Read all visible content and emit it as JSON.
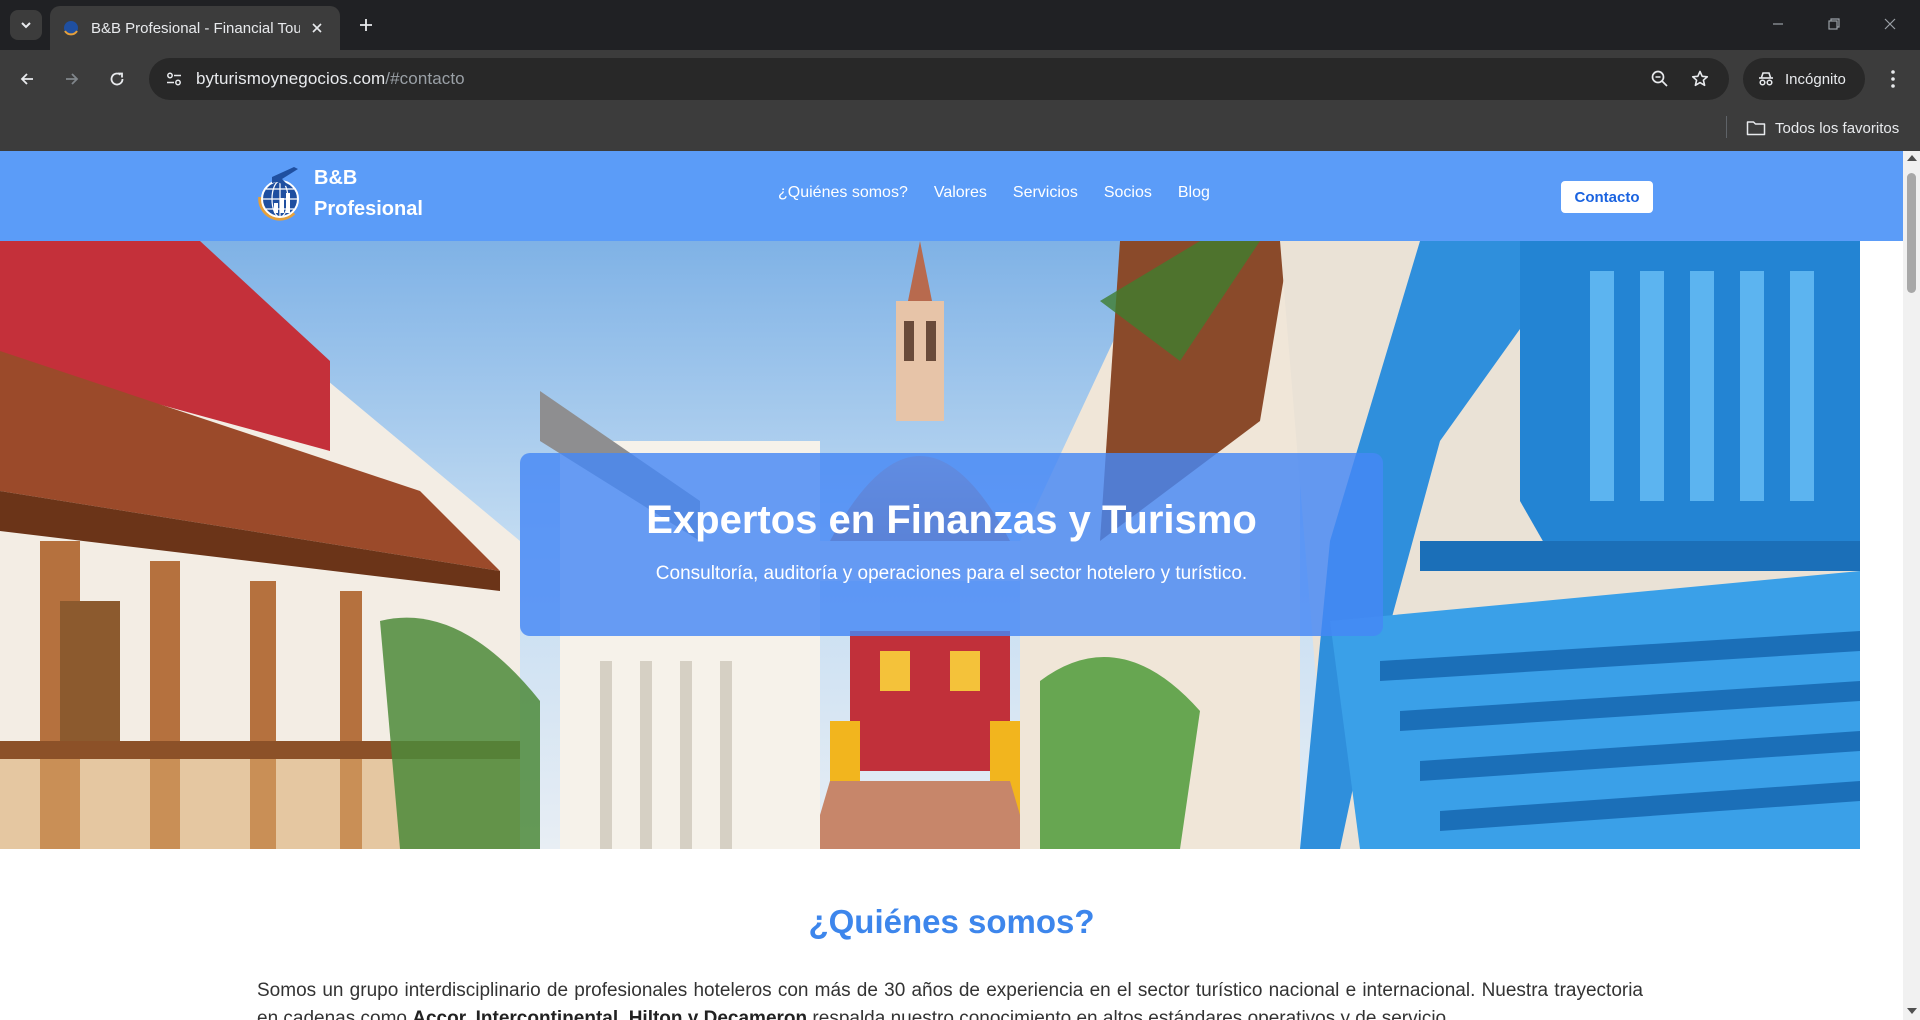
{
  "browser": {
    "tab_title": "B&B Profesional - Financial Tou",
    "url_host": "byturismoynegocios.com",
    "url_path": "/#contacto",
    "incognito_label": "Incógnito",
    "bookmarks_all": "Todos los favoritos"
  },
  "site": {
    "logo_line1": "B&B",
    "logo_line2": "Profesional",
    "nav": [
      "¿Quiénes somos?",
      "Valores",
      "Servicios",
      "Socios",
      "Blog"
    ],
    "contact_button": "Contacto",
    "accent_color": "#5b9cf8"
  },
  "hero": {
    "title": "Expertos en Finanzas y Turismo",
    "subtitle": "Consultoría, auditoría y operaciones para el sector hotelero y turístico."
  },
  "about": {
    "title": "¿Quiénes somos?",
    "text_part1": "Somos un grupo interdisciplinario de profesionales hoteleros con más de 30 años de experiencia en el sector turístico nacional e internacional. Nuestra trayectoria en cadenas como ",
    "text_bold": "Accor, Intercontinental, Hilton y Decameron",
    "text_part2": " respalda nuestro conocimiento en altos estándares operativos y de servicio."
  }
}
